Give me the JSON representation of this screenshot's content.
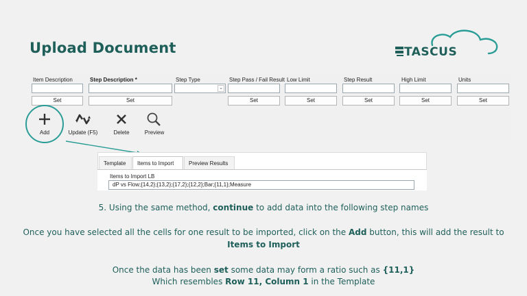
{
  "page": {
    "title": "Upload Document"
  },
  "logo": {
    "text": "TASCUS"
  },
  "form": {
    "columns": [
      {
        "label": "Item Description",
        "bold": false,
        "set": "Set"
      },
      {
        "label": "Step Description *",
        "bold": true,
        "set": "Set"
      },
      {
        "label": "Step Type",
        "bold": false,
        "set": ""
      },
      {
        "label": "Step Pass / Fail Result",
        "bold": false,
        "set": "Set"
      },
      {
        "label": "Low Limit",
        "bold": false,
        "set": "Set"
      },
      {
        "label": "Step Result",
        "bold": false,
        "set": "Set"
      },
      {
        "label": "High Limit",
        "bold": false,
        "set": "Set"
      },
      {
        "label": "Units",
        "bold": false,
        "set": "Set"
      }
    ]
  },
  "toolbar": {
    "add": "Add",
    "update": "Update (F5)",
    "delete": "Delete",
    "preview": "Preview"
  },
  "tabs": {
    "items": [
      "Template",
      "Items to Import",
      "Preview Results"
    ],
    "active": "Items to Import",
    "content_label": "Items to Import LB",
    "content_value": "dP vs Flow;{14,2};{13,2};{17,2};{12,2};Bar;{11,1};Measure"
  },
  "instructions": {
    "step5_prefix": "5. Using the same method, ",
    "step5_bold": "continue",
    "step5_suffix": " to add data into the following step names",
    "p2_prefix": "Once you have selected all the cells for one result to be imported, click on the ",
    "p2_bold": "Add",
    "p2_suffix": " button, this will add the result to",
    "p2_line2_bold": "Items to Import",
    "p3_prefix": "Once the data has been ",
    "p3_bold1": "set",
    "p3_mid": " some data may form a ratio such as ",
    "p3_bold2": "{11,1}",
    "p3_line2_prefix": "Which resembles ",
    "p3_line2_bold": "Row 11, Column 1",
    "p3_line2_suffix": " in the Template"
  },
  "colors": {
    "accent": "#1e5f5a",
    "highlight": "#2a9d96"
  }
}
